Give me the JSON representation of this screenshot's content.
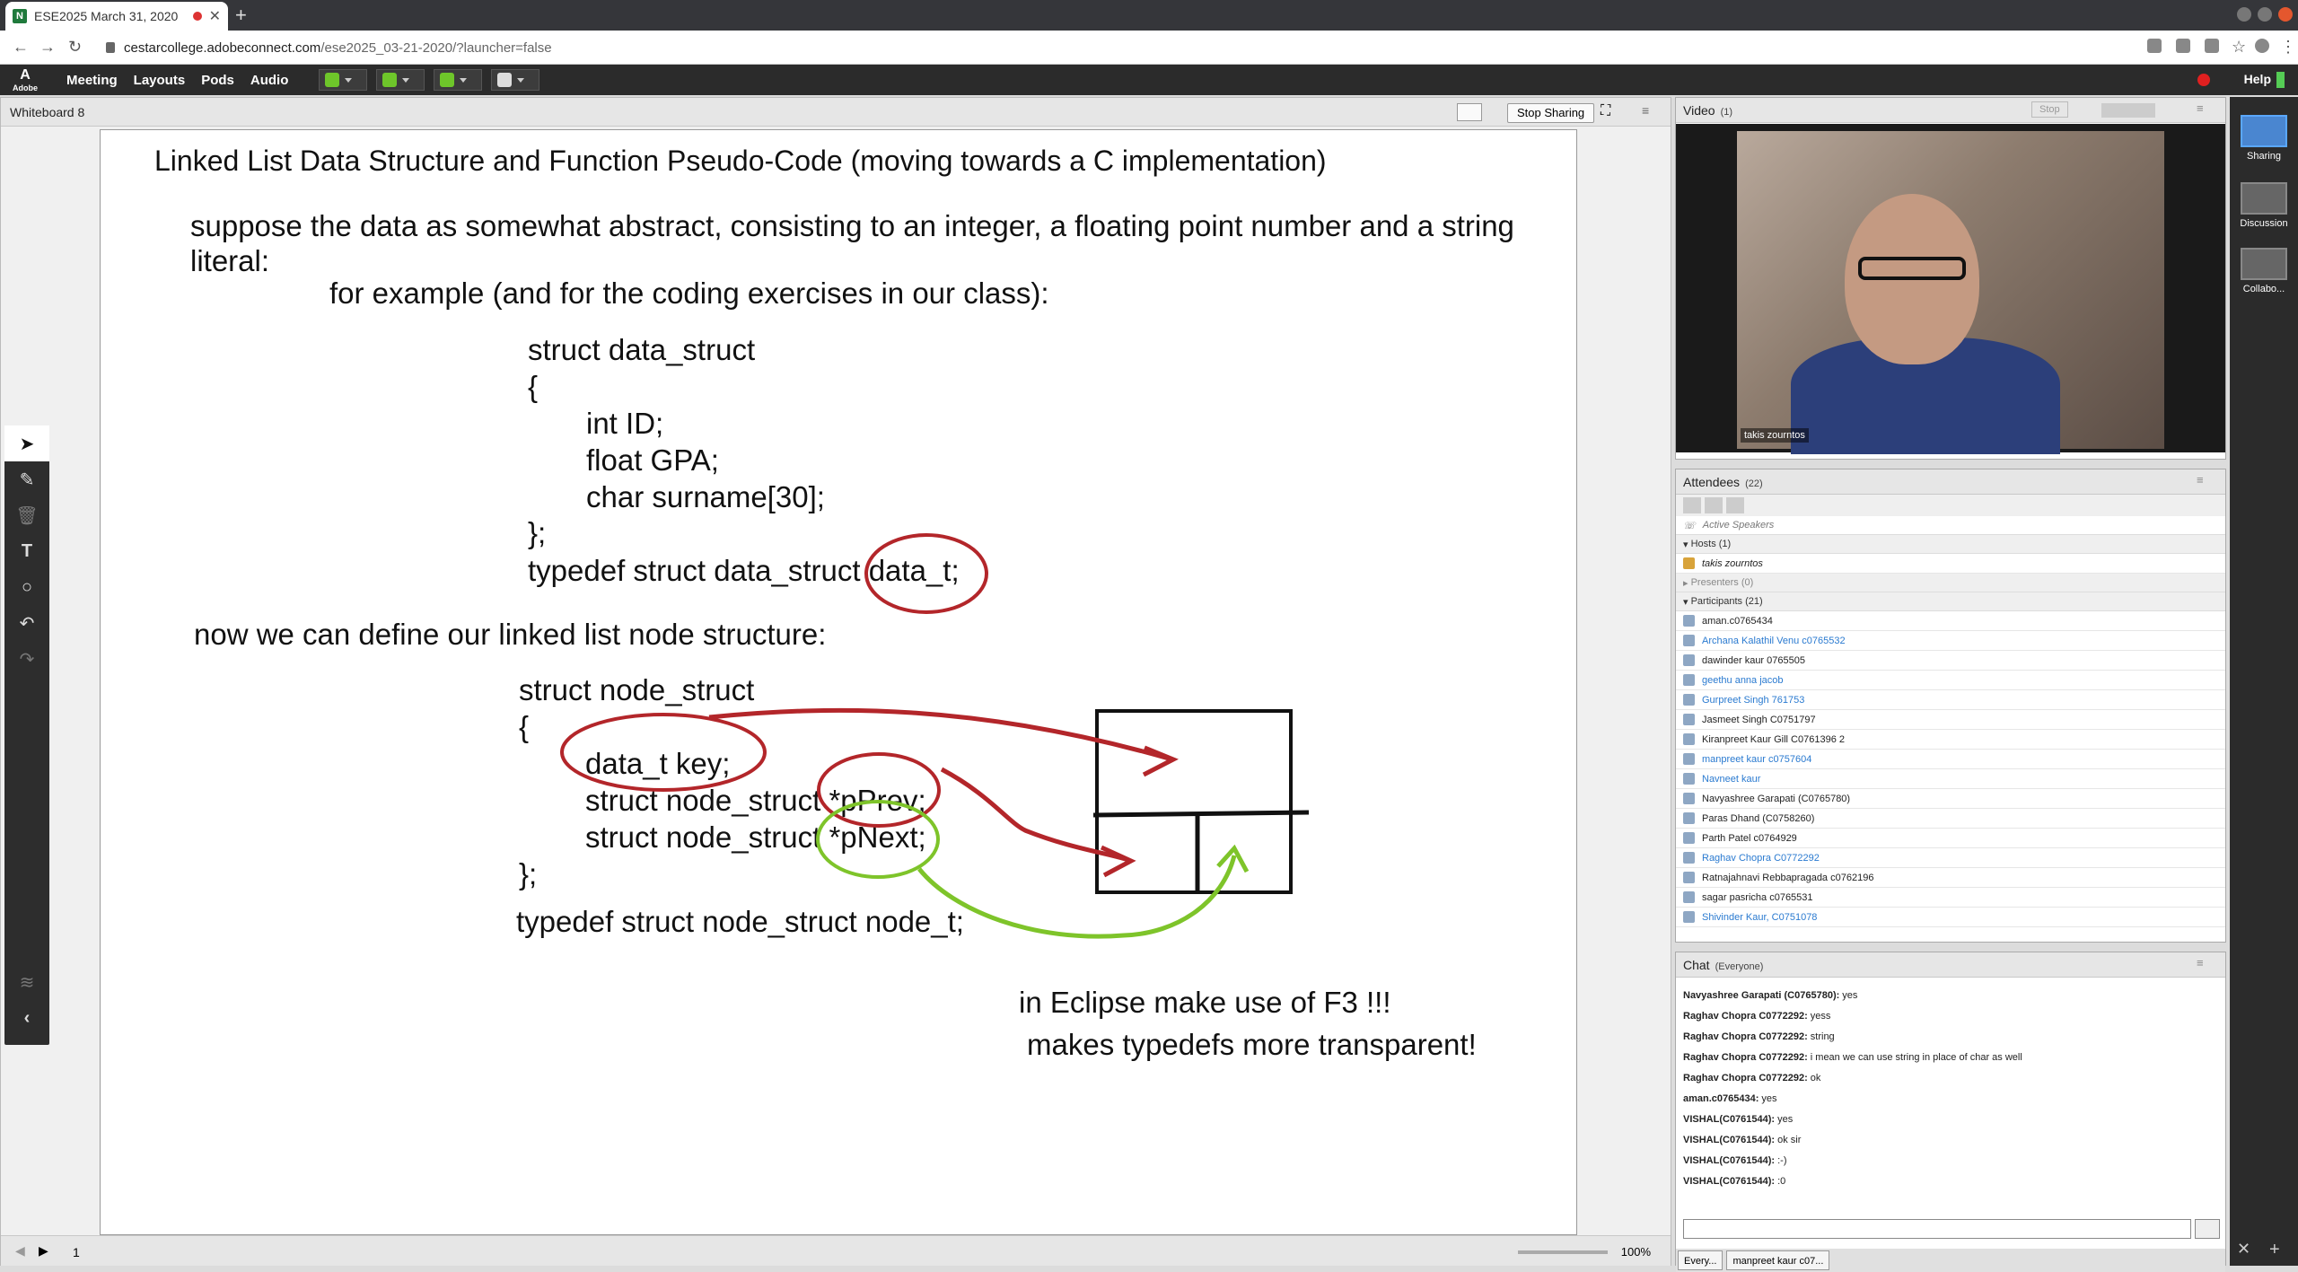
{
  "browser": {
    "tab_title": "ESE2025 March 31, 2020",
    "url_host": "cestarcollege.adobeconnect.com",
    "url_path": "/ese2025_03-21-2020/?launcher=false"
  },
  "appbar": {
    "logo": "Adobe",
    "menus": [
      "Meeting",
      "Layouts",
      "Pods",
      "Audio"
    ],
    "help": "Help"
  },
  "whiteboard": {
    "title": "Whiteboard 8",
    "stop_sharing": "Stop Sharing",
    "page": "1",
    "zoom": "100%",
    "lines": [
      "Linked List Data Structure and Function Pseudo-Code (moving towards a C implementation)",
      "suppose the data as somewhat abstract, consisting to an integer, a floating point number and a string",
      "literal:",
      "for example (and for the coding exercises in our class):",
      "struct data_struct",
      "{",
      "int ID;",
      "float GPA;",
      "char surname[30];",
      "};",
      "typedef struct data_struct data_t;",
      "now we can define our linked list node structure:",
      "struct node_struct",
      "{",
      "data_t key;",
      "struct node_struct *pPrev;",
      "struct node_struct *pNext;",
      "};",
      "typedef struct node_struct node_t;",
      "in Eclipse make use of F3 !!!",
      "makes typedefs more transparent!"
    ]
  },
  "video": {
    "title": "Video",
    "count": "(1)",
    "stop": "Stop",
    "cam_label": "takis zourntos"
  },
  "attendees": {
    "title": "Attendees",
    "count": "(22)",
    "active_speakers": "Active Speakers",
    "hosts_label": "Hosts (1)",
    "host": "takis zourntos",
    "presenters_label": "Presenters (0)",
    "participants_label": "Participants (21)",
    "participants": [
      {
        "name": "aman.c0765434",
        "style": "dark"
      },
      {
        "name": "Archana Kalathil Venu c0765532",
        "style": "blue"
      },
      {
        "name": "dawinder kaur 0765505",
        "style": "dark"
      },
      {
        "name": "geethu anna jacob",
        "style": "blue"
      },
      {
        "name": "Gurpreet Singh 761753",
        "style": "blue"
      },
      {
        "name": "Jasmeet Singh C0751797",
        "style": "dark"
      },
      {
        "name": "Kiranpreet Kaur Gill C0761396 2",
        "style": "dark"
      },
      {
        "name": "manpreet kaur c0757604",
        "style": "blue"
      },
      {
        "name": "Navneet kaur",
        "style": "blue"
      },
      {
        "name": "Navyashree Garapati (C0765780)",
        "style": "dark"
      },
      {
        "name": "Paras Dhand (C0758260)",
        "style": "dark"
      },
      {
        "name": "Parth Patel c0764929",
        "style": "dark"
      },
      {
        "name": "Raghav Chopra C0772292",
        "style": "blue"
      },
      {
        "name": "Ratnajahnavi Rebbapragada c0762196",
        "style": "dark"
      },
      {
        "name": "sagar pasricha c0765531",
        "style": "dark"
      },
      {
        "name": "Shivinder Kaur, C0751078",
        "style": "blue"
      }
    ]
  },
  "chat": {
    "title": "Chat",
    "scope": "(Everyone)",
    "messages": [
      {
        "from": "Navyashree Garapati (C0765780):",
        "text": "yes"
      },
      {
        "from": "Raghav Chopra C0772292:",
        "text": "yess"
      },
      {
        "from": "Raghav Chopra C0772292:",
        "text": "string"
      },
      {
        "from": "Raghav Chopra C0772292:",
        "text": "i mean we can use string in place of char as well"
      },
      {
        "from": "Raghav Chopra C0772292:",
        "text": "ok"
      },
      {
        "from": "aman.c0765434:",
        "text": "yes"
      },
      {
        "from": "VISHAL(C0761544):",
        "text": "yes"
      },
      {
        "from": "VISHAL(C0761544):",
        "text": "ok sir"
      },
      {
        "from": "VISHAL(C0761544):",
        "text": ":-)"
      },
      {
        "from": "VISHAL(C0761544):",
        "text": ":0"
      }
    ],
    "tabs": [
      "Every...",
      "manpreet kaur c07..."
    ]
  },
  "layouts": [
    {
      "label": "Sharing"
    },
    {
      "label": "Discussion"
    },
    {
      "label": "Collabo..."
    }
  ],
  "colors": {
    "ink_red": "#b3262a",
    "ink_green": "#7ec42a",
    "link_blue": "#2a7ad0"
  }
}
